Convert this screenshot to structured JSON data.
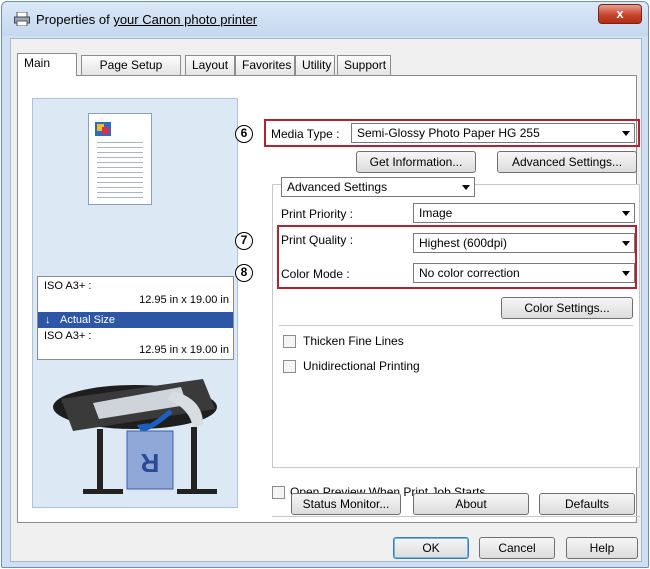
{
  "window": {
    "title_prefix": "Properties of ",
    "title_highlight": "your Canon photo printer",
    "close_label": "x"
  },
  "tabs": [
    {
      "label": "Main",
      "active": true
    },
    {
      "label": "Page Setup"
    },
    {
      "label": "Layout"
    },
    {
      "label": "Favorites"
    },
    {
      "label": "Utility"
    },
    {
      "label": "Support"
    }
  ],
  "preview": {
    "input_size_label": "ISO A3+ :",
    "input_size_value": "12.95 in x 19.00 in",
    "actual_size_label": "Actual Size",
    "output_size_label": "ISO A3+ :",
    "output_size_value": "12.95 in x 19.00 in",
    "paper_letter": "R"
  },
  "annotations": {
    "media": "6",
    "quality": "7",
    "color": "8",
    "frame_color": "#b02334"
  },
  "media": {
    "label": "Media Type :",
    "value": "Semi-Glossy Photo Paper HG 255",
    "get_info_button": "Get Information...",
    "advanced_button": "Advanced Settings..."
  },
  "settings": {
    "mode_value": "Advanced Settings",
    "print_priority_label": "Print Priority :",
    "print_priority_value": "Image",
    "print_quality_label": "Print Quality :",
    "print_quality_value": "Highest (600dpi)",
    "color_mode_label": "Color Mode :",
    "color_mode_value": "No color correction",
    "color_settings_button": "Color Settings...",
    "thicken_lines_label": "Thicken Fine Lines",
    "unidirectional_label": "Unidirectional Printing"
  },
  "open_preview_label": "Open Preview When Print Job Starts",
  "footer": {
    "status_monitor_button": "Status Monitor...",
    "about_button": "About",
    "defaults_button": "Defaults"
  },
  "dialog": {
    "ok_button": "OK",
    "cancel_button": "Cancel",
    "help_button": "Help"
  }
}
